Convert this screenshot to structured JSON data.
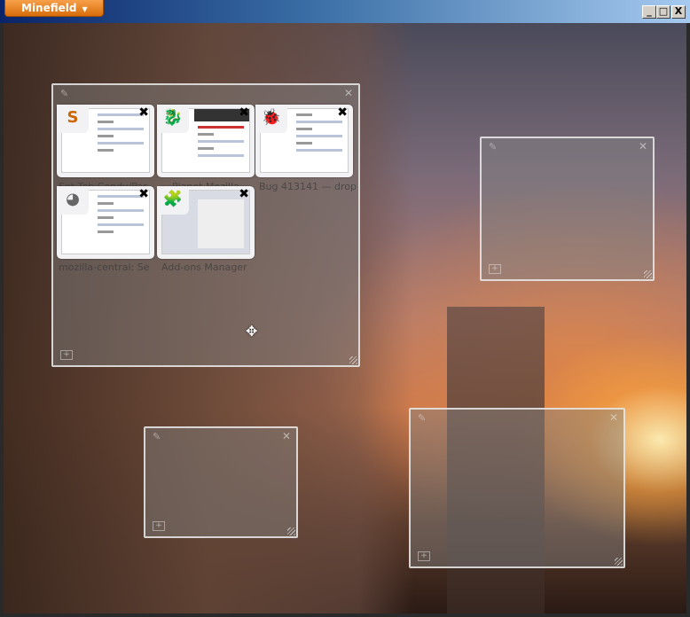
{
  "window": {
    "app_button": "Minefield",
    "minimize": "_",
    "maximize": "□",
    "close": "X"
  },
  "groups": [
    {
      "tabs": [
        {
          "title": "Set Tab Candy/Par",
          "favicon": "S"
        },
        {
          "title": "Planet Mozilla",
          "favicon": "🐉"
        },
        {
          "title": "Bug 413141 — drop",
          "favicon": "🐞"
        },
        {
          "title": "mozilla-central: Se",
          "favicon": "◕"
        },
        {
          "title": "Add-ons Manager",
          "favicon": "🧩"
        }
      ]
    }
  ],
  "icons": {
    "close": "✕",
    "tab_close": "✖",
    "pencil": "✎",
    "new_tab": "+",
    "move": "✥"
  }
}
